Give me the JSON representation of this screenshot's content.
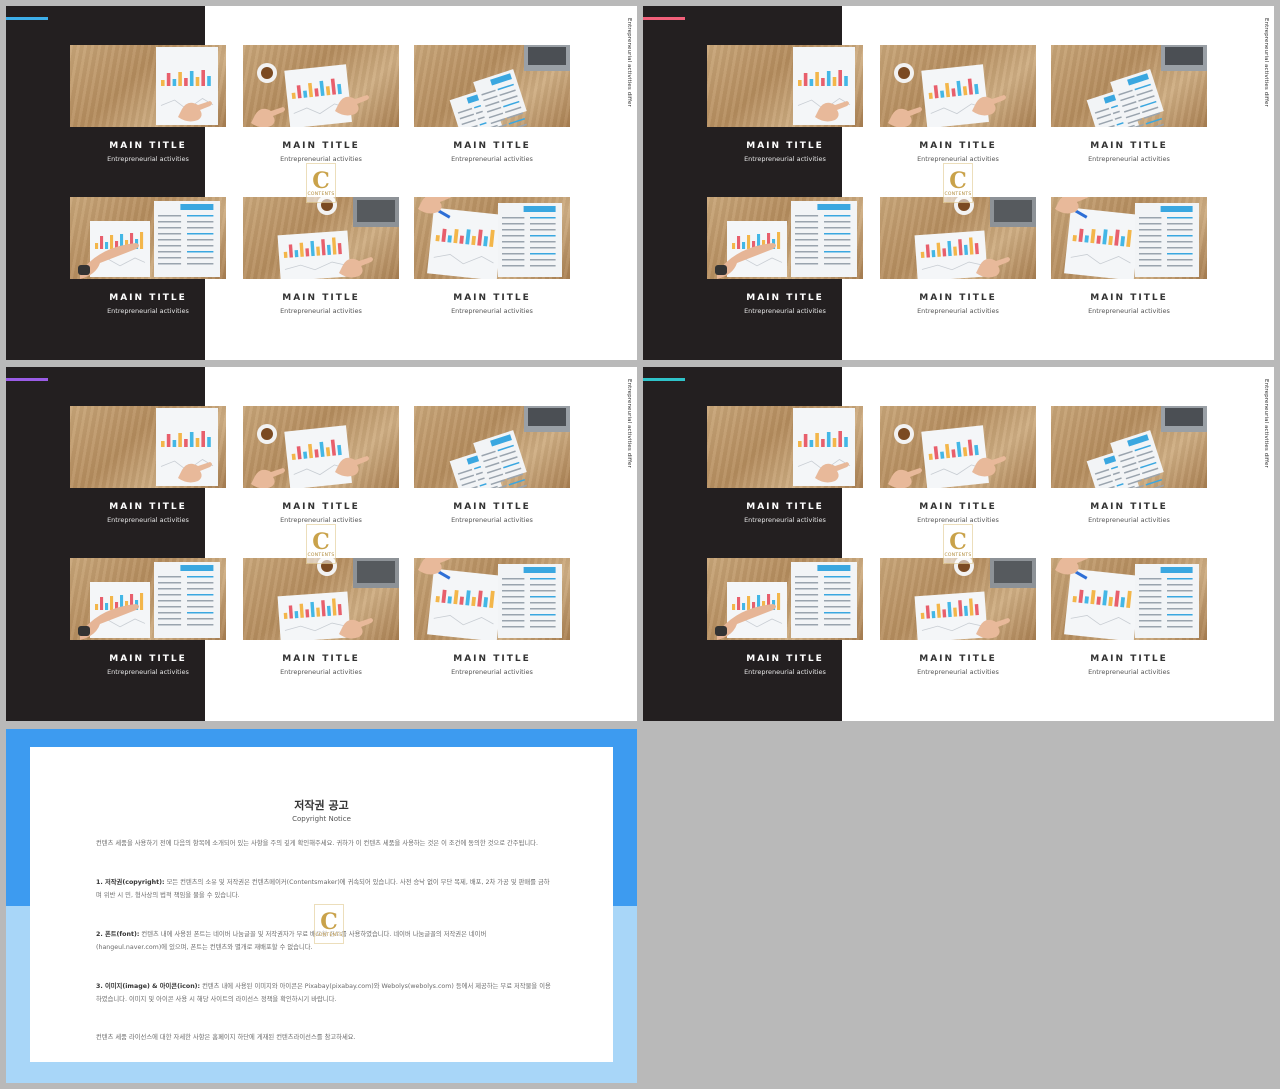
{
  "slides": [
    {
      "accent": "#3daee9",
      "side_text": "Entrepreneurial activities differ",
      "cards": [
        {
          "title": "MAIN TITLE",
          "subtitle": "Entrepreneurial activities",
          "photo": "chart-paper-hand"
        },
        {
          "title": "MAIN TITLE",
          "subtitle": "Entrepreneurial activities",
          "photo": "coffee-chart-hand"
        },
        {
          "title": "MAIN TITLE",
          "subtitle": "Entrepreneurial activities",
          "photo": "laptop-report"
        },
        {
          "title": "MAIN TITLE",
          "subtitle": "Entrepreneurial activities",
          "photo": "watch-chart-report"
        },
        {
          "title": "MAIN TITLE",
          "subtitle": "Entrepreneurial activities",
          "photo": "coffee-laptop-chart"
        },
        {
          "title": "MAIN TITLE",
          "subtitle": "Entrepreneurial activities",
          "photo": "pen-chart-report"
        }
      ]
    },
    {
      "accent": "#f2607a",
      "side_text": "Entrepreneurial activities differ",
      "cards": [
        {
          "title": "MAIN TITLE",
          "subtitle": "Entrepreneurial activities",
          "photo": "chart-paper-hand"
        },
        {
          "title": "MAIN TITLE",
          "subtitle": "Entrepreneurial activities",
          "photo": "coffee-chart-hand"
        },
        {
          "title": "MAIN TITLE",
          "subtitle": "Entrepreneurial activities",
          "photo": "laptop-report"
        },
        {
          "title": "MAIN TITLE",
          "subtitle": "Entrepreneurial activities",
          "photo": "watch-chart-report"
        },
        {
          "title": "MAIN TITLE",
          "subtitle": "Entrepreneurial activities",
          "photo": "coffee-laptop-chart"
        },
        {
          "title": "MAIN TITLE",
          "subtitle": "Entrepreneurial activities",
          "photo": "pen-chart-report"
        }
      ]
    },
    {
      "accent": "#9a5ce6",
      "side_text": "Entrepreneurial activities differ",
      "cards": [
        {
          "title": "MAIN TITLE",
          "subtitle": "Entrepreneurial activities",
          "photo": "chart-paper-hand"
        },
        {
          "title": "MAIN TITLE",
          "subtitle": "Entrepreneurial activities",
          "photo": "coffee-chart-hand"
        },
        {
          "title": "MAIN TITLE",
          "subtitle": "Entrepreneurial activities",
          "photo": "laptop-report"
        },
        {
          "title": "MAIN TITLE",
          "subtitle": "Entrepreneurial activities",
          "photo": "watch-chart-report"
        },
        {
          "title": "MAIN TITLE",
          "subtitle": "Entrepreneurial activities",
          "photo": "coffee-laptop-chart"
        },
        {
          "title": "MAIN TITLE",
          "subtitle": "Entrepreneurial activities",
          "photo": "pen-chart-report"
        }
      ]
    },
    {
      "accent": "#2fc3c9",
      "side_text": "Entrepreneurial activities differ",
      "cards": [
        {
          "title": "MAIN TITLE",
          "subtitle": "Entrepreneurial activities",
          "photo": "chart-paper-hand"
        },
        {
          "title": "MAIN TITLE",
          "subtitle": "Entrepreneurial activities",
          "photo": "coffee-chart-hand"
        },
        {
          "title": "MAIN TITLE",
          "subtitle": "Entrepreneurial activities",
          "photo": "laptop-report"
        },
        {
          "title": "MAIN TITLE",
          "subtitle": "Entrepreneurial activities",
          "photo": "watch-chart-report"
        },
        {
          "title": "MAIN TITLE",
          "subtitle": "Entrepreneurial activities",
          "photo": "coffee-laptop-chart"
        },
        {
          "title": "MAIN TITLE",
          "subtitle": "Entrepreneurial activities",
          "photo": "pen-chart-report"
        }
      ]
    }
  ],
  "watermark": {
    "letter": "C",
    "text": "CONTENTS"
  },
  "copyright": {
    "title": "저작권 공고",
    "subtitle": "Copyright Notice",
    "intro": "컨텐츠 세품을 사용하기 전에 다음의 항목에 소개되어 있는 사항을 주의 깊게 확인해주세요. 귀하가 이 컨텐츠 세품을 사용하는 것은 이 조건에 동의한 것으로 간주됩니다.",
    "p1_label": "1. 저작권(copyright):",
    "p1": "모든 컨텐츠의 소유 및 저작권은 컨텐츠메이커(Contentsmaker)에 귀속되어 있습니다. 사전 승낙 없이 무단 복제, 배포, 2차 가공 및 판매를 금하며 위반 시 민, 형사상의 법적 책임을 물을 수 있습니다.",
    "p2_label": "2. 폰트(font):",
    "p2": "컨텐츠 내에 사용된 폰트는 네이버 나눔글꼴 및 저작권자가 무료 배포한 폰트를 사용하였습니다. 네이버 나눔글꼴의 저작권은 네이버(hangeul.naver.com)에 있으며, 폰트는 컨텐츠와 별개로 재배포할 수 없습니다.",
    "p3_label": "3. 이미지(image) & 아이콘(icon):",
    "p3": "컨텐츠 내에 사용된 이미지와 아이콘은 Pixabay(pixabay.com)와 Webolys(webolys.com) 등에서 제공하는 무료 저작물을 이용하였습니다. 이미지 및 아이콘 사용 시 해당 사이트의 라이선스 정책을 확인하시기 바랍니다.",
    "outro": "컨텐츠 세품 라이선스에 대한 자세한 사항은 홈페이지 하단에 게재된 컨텐츠라이선스를 참고하세요."
  }
}
